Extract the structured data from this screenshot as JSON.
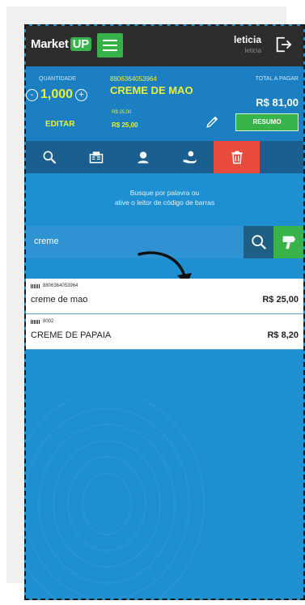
{
  "header": {
    "logo_text": "Market",
    "logo_badge": "UP",
    "user_name": "leticia",
    "user_sub": "leticia"
  },
  "summary": {
    "qty_label": "QUANTIDADE",
    "qty_value": "1,000",
    "minus": "-",
    "plus": "+",
    "edit_label": "EDITAR",
    "barcode": "8806364053964",
    "product_name": "CREME DE MAO",
    "price_small": "R$ 25,00",
    "price_main": "R$ 25,00",
    "total_label": "TOTAL A PAGAR",
    "total_value": "R$ 81,00",
    "summary_button": "RESUMO"
  },
  "hint": {
    "line1": "Busque por palavra ou",
    "line2": "ative o leitor de código de barras"
  },
  "search": {
    "value": "creme"
  },
  "results": [
    {
      "code": "8806364053964",
      "name": "creme de mao",
      "price": "R$ 25,00"
    },
    {
      "code": "8002",
      "name": "CREME DE PAPAIA",
      "price": "R$ 8,20"
    }
  ],
  "colors": {
    "accent_green": "#37b34a",
    "header_dark": "#2d2d2d",
    "primary_blue": "#1c7fc1",
    "highlight_yellow": "#e8f03a",
    "delete_red": "#e84a3c"
  }
}
